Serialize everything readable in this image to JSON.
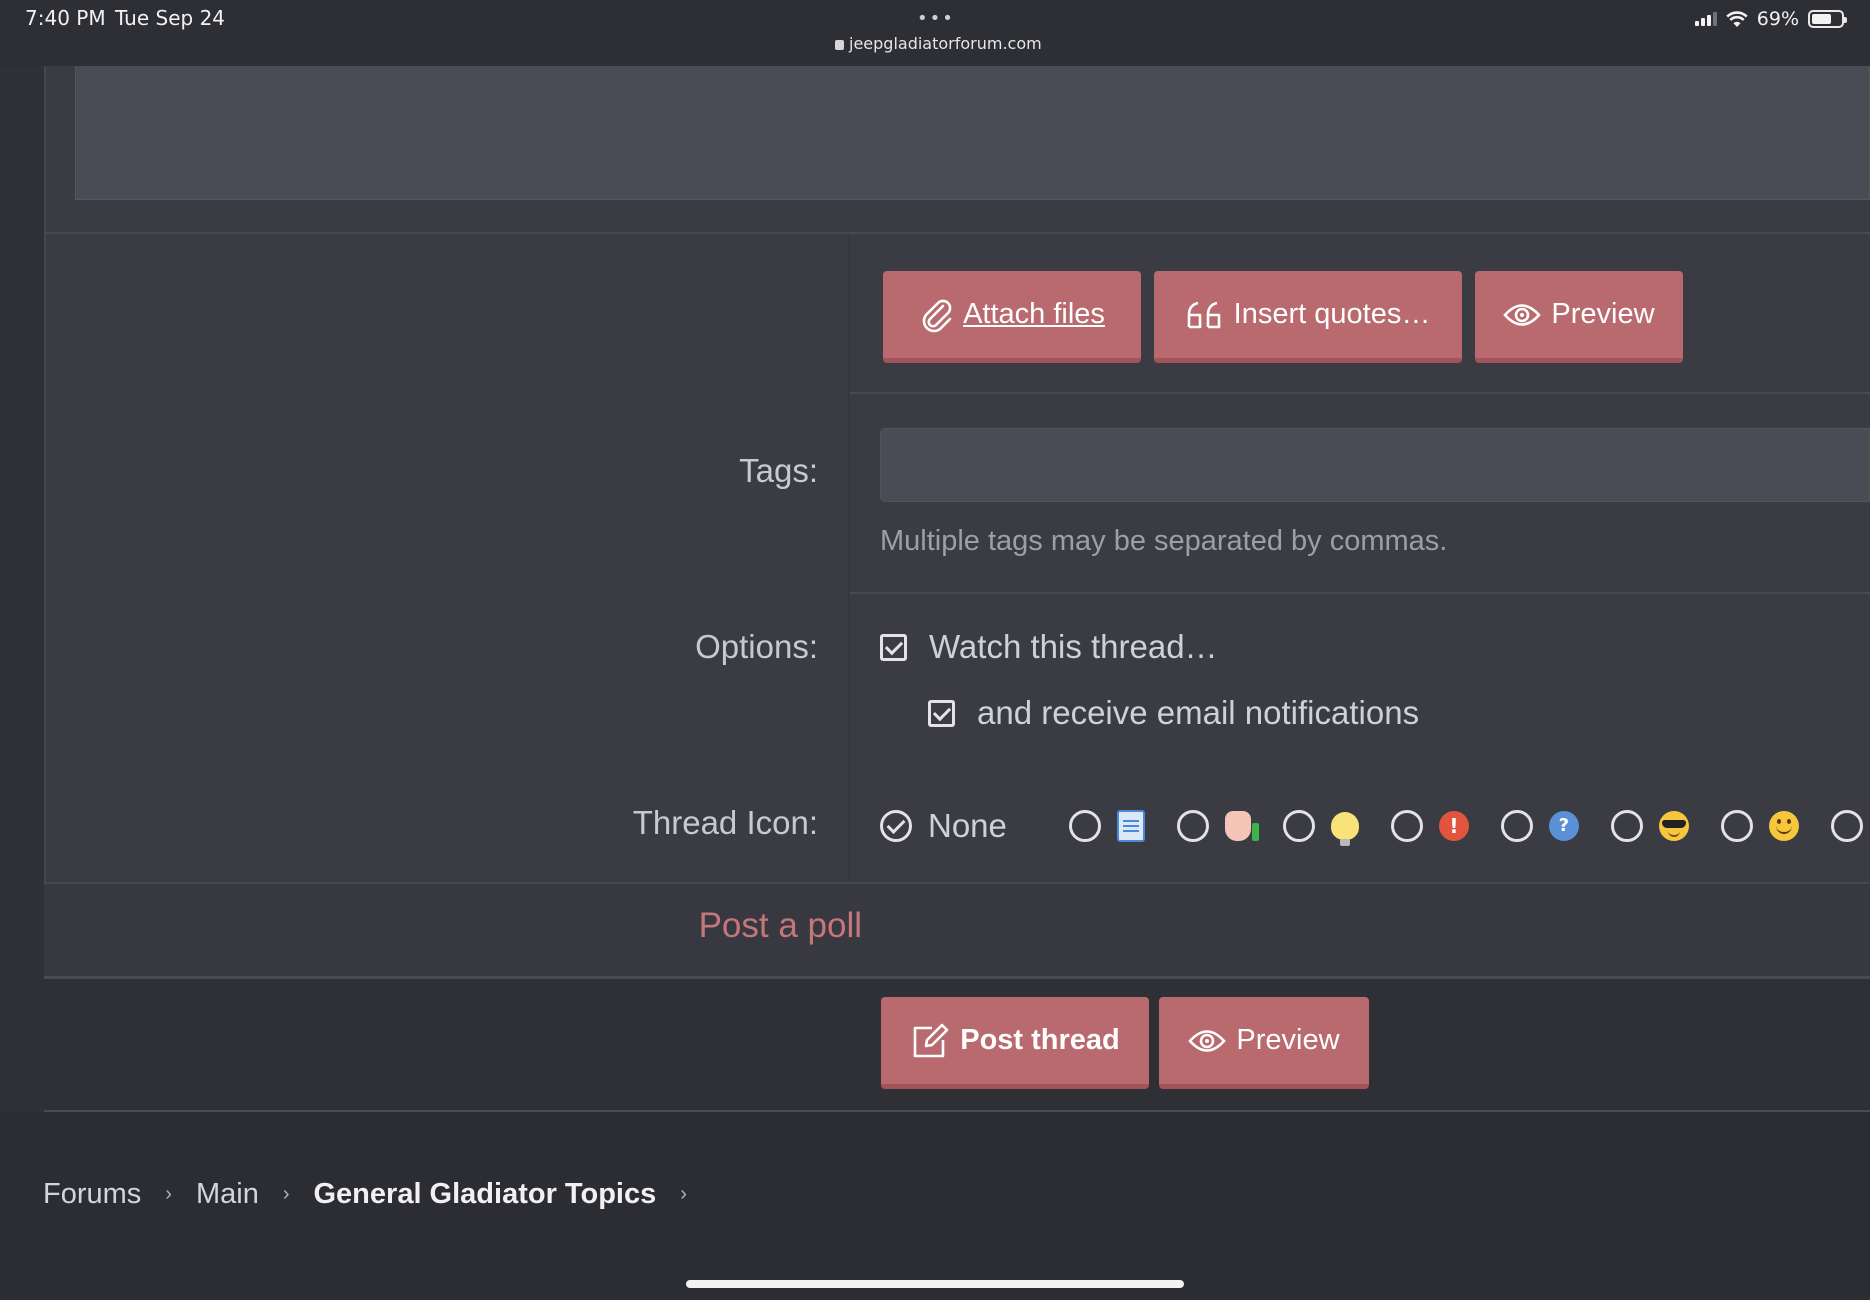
{
  "status_bar": {
    "time": "7:40 PM",
    "date": "Tue Sep 24",
    "url": "jeepgladiatorforum.com",
    "battery": "69%",
    "battery_level": 0.69
  },
  "toolbar": {
    "attach_files": "Attach files",
    "insert_quotes": "Insert quotes…",
    "preview": "Preview"
  },
  "tags": {
    "label": "Tags:",
    "value": "",
    "hint": "Multiple tags may be separated by commas."
  },
  "options": {
    "label": "Options:",
    "watch_thread": "Watch this thread…",
    "email_notifications": "and receive email notifications",
    "watch_checked": true,
    "email_checked": true
  },
  "thread_icon": {
    "label": "Thread Icon:",
    "none_label": "None",
    "selected": "None",
    "icons": [
      "document-icon",
      "thumbs-up-icon",
      "lightbulb-icon",
      "exclamation-icon",
      "question-icon",
      "cool-icon",
      "smile-icon"
    ]
  },
  "poll": {
    "link": "Post a poll"
  },
  "submit": {
    "post_thread": "Post thread",
    "preview": "Preview"
  },
  "breadcrumb": {
    "items": [
      "Forums",
      "Main",
      "General Gladiator Topics"
    ]
  },
  "colors": {
    "accent": "#b96a6e",
    "page_bg": "#2c2d33",
    "panel_bg": "#3a3b43",
    "link": "#c4777a"
  }
}
